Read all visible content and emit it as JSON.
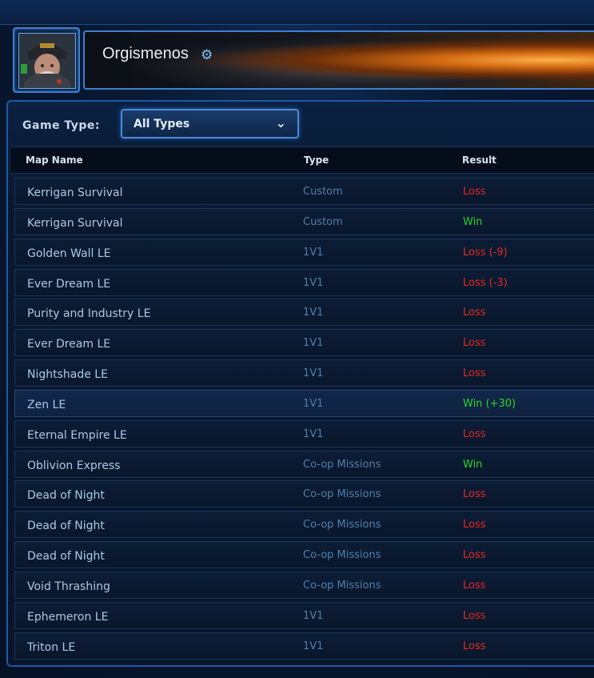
{
  "player": {
    "name": "Orgismenos",
    "settings_icon": "gear-icon"
  },
  "filter": {
    "label": "Game Type:",
    "selected": "All Types",
    "icon": "chevron-down-icon"
  },
  "table": {
    "headers": {
      "map": "Map Name",
      "type": "Type",
      "result": "Result"
    },
    "rows": [
      {
        "map": "Kerrigan Survival",
        "type": "Custom",
        "result": "Loss",
        "outcome": "loss"
      },
      {
        "map": "Kerrigan Survival",
        "type": "Custom",
        "result": "Win",
        "outcome": "win"
      },
      {
        "map": "Golden Wall LE",
        "type": "1V1",
        "result": "Loss (-9)",
        "outcome": "loss"
      },
      {
        "map": "Ever Dream LE",
        "type": "1V1",
        "result": "Loss (-3)",
        "outcome": "loss"
      },
      {
        "map": "Purity and Industry LE",
        "type": "1V1",
        "result": "Loss",
        "outcome": "loss"
      },
      {
        "map": "Ever Dream LE",
        "type": "1V1",
        "result": "Loss",
        "outcome": "loss"
      },
      {
        "map": "Nightshade LE",
        "type": "1V1",
        "result": "Loss",
        "outcome": "loss"
      },
      {
        "map": "Zen LE",
        "type": "1V1",
        "result": "Win (+30)",
        "outcome": "win"
      },
      {
        "map": "Eternal Empire LE",
        "type": "1V1",
        "result": "Loss",
        "outcome": "loss"
      },
      {
        "map": "Oblivion Express",
        "type": "Co-op Missions",
        "result": "Win",
        "outcome": "win"
      },
      {
        "map": "Dead of Night",
        "type": "Co-op Missions",
        "result": "Loss",
        "outcome": "loss"
      },
      {
        "map": "Dead of Night",
        "type": "Co-op Missions",
        "result": "Loss",
        "outcome": "loss"
      },
      {
        "map": "Dead of Night",
        "type": "Co-op Missions",
        "result": "Loss",
        "outcome": "loss"
      },
      {
        "map": "Void Thrashing",
        "type": "Co-op Missions",
        "result": "Loss",
        "outcome": "loss"
      },
      {
        "map": "Ephemeron LE",
        "type": "1V1",
        "result": "Loss",
        "outcome": "loss"
      },
      {
        "map": "Triton LE",
        "type": "1V1",
        "result": "Loss",
        "outcome": "loss"
      }
    ]
  },
  "colors": {
    "win": "#2ad62a",
    "loss": "#e8261e",
    "accent": "#3f7fd0"
  }
}
